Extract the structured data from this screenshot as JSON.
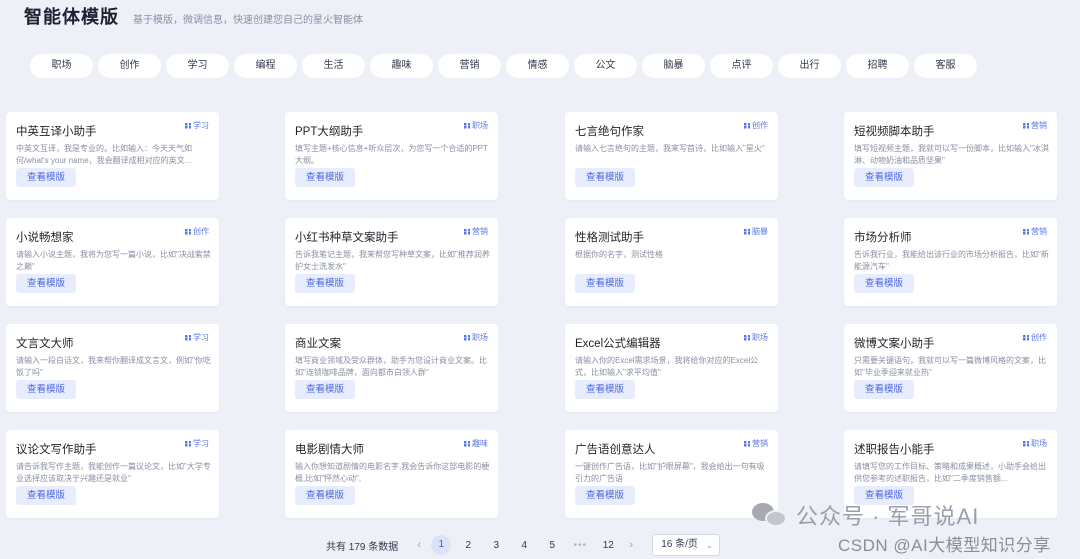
{
  "header": {
    "title": "智能体模版",
    "subtitle": "基于模版，微调信息，快速创建您自己的星火智能体"
  },
  "tags": [
    "职场",
    "创作",
    "学习",
    "编程",
    "生活",
    "趣味",
    "营销",
    "情感",
    "公文",
    "脑暴",
    "点评",
    "出行",
    "招聘",
    "客服"
  ],
  "cards": [
    {
      "name": "中英互译小助手",
      "cat": "学习",
      "desc": "中英文互译，我是专业的。比如输入：今天天气如何/what's your name，我会翻译成相对应的英文...",
      "btn": "查看模版"
    },
    {
      "name": "PPT大纲助手",
      "cat": "职场",
      "desc": "填写主题+核心信息+听众层次，为您写一个合适的PPT大纲。",
      "btn": "查看模版"
    },
    {
      "name": "七言绝句作家",
      "cat": "创作",
      "desc": "请输入七言绝句的主题，我来写首诗，比如输入\"星火\"",
      "btn": "查看模版"
    },
    {
      "name": "短视频脚本助手",
      "cat": "营销",
      "desc": "填写短视频主题，我就可以写一份脚本，比如输入\"冰淇淋、动物奶油和品质坚果\"",
      "btn": "查看模版"
    },
    {
      "name": "小说畅想家",
      "cat": "创作",
      "desc": "请输入小说主题，我将为您写一篇小说，比如\"决战紫禁之巅\"",
      "btn": "查看模版"
    },
    {
      "name": "小红书种草文案助手",
      "cat": "营销",
      "desc": "告诉我笔记主题，我来帮您写种草文案，比如\"推荐润养护女士洗发水\"",
      "btn": "查看模版"
    },
    {
      "name": "性格测试助手",
      "cat": "脑暴",
      "desc": "根据你的名字，测试性格",
      "btn": "查看模版"
    },
    {
      "name": "市场分析师",
      "cat": "营销",
      "desc": "告诉我行业，我能给出该行业的市场分析报告，比如\"新能源汽车\"",
      "btn": "查看模版"
    },
    {
      "name": "文言文大师",
      "cat": "学习",
      "desc": "请输入一段白话文，我来帮你翻译成文言文，例如\"你吃饭了吗\"",
      "btn": "查看模版"
    },
    {
      "name": "商业文案",
      "cat": "职场",
      "desc": "填写商业领域及受众群体，助手为您设计商业文案。比如\"连锁咖啡品牌，面向都市白领人群\"",
      "btn": "查看模版"
    },
    {
      "name": "Excel公式编辑器",
      "cat": "职场",
      "desc": "请输入你的Excel需求场景，我将给你对应的Excel公式，比如输入\"求平均值\"",
      "btn": "查看模版"
    },
    {
      "name": "微博文案小助手",
      "cat": "创作",
      "desc": "只需要关键语句，我就可以写一篇微博风格的文案，比如\"毕业季迎来就业热\"",
      "btn": "查看模版"
    },
    {
      "name": "议论文写作助手",
      "cat": "学习",
      "desc": "请告诉我写作主题，我能创作一篇议论文，比如\"大学专业选择应该取决于兴趣还是就业\"",
      "btn": "查看模版"
    },
    {
      "name": "电影剧情大师",
      "cat": "趣味",
      "desc": "输入你想知道剧情的电影名字,我会告诉你这部电影的梗概,比如\"怦然心动\",",
      "btn": "查看模版"
    },
    {
      "name": "广告语创意达人",
      "cat": "营销",
      "desc": "一键创作广告语，比如\"护眼屏幕\"，我会给出一句有吸引力的广告语",
      "btn": "查看模版"
    },
    {
      "name": "述职报告小能手",
      "cat": "职场",
      "desc": "请填写您的工作目标、策略和成果概述，小助手会给出供您参考的述职报告，比如\"二季度销售额...",
      "btn": "查看模版"
    }
  ],
  "pagination": {
    "total_text": "共有 179 条数据",
    "prev": "‹",
    "pages": [
      "1",
      "2",
      "3",
      "4",
      "5"
    ],
    "dots": "•••",
    "last": "12",
    "next": "›",
    "page_size": "16 条/页",
    "size_chevron": "⌄"
  },
  "watermarks": {
    "wechat": "公众号 · 军哥说AI",
    "csdn": "CSDN @AI大模型知识分享"
  },
  "colors": {
    "accent": "#4a67e0",
    "background": "#eef0f8"
  }
}
